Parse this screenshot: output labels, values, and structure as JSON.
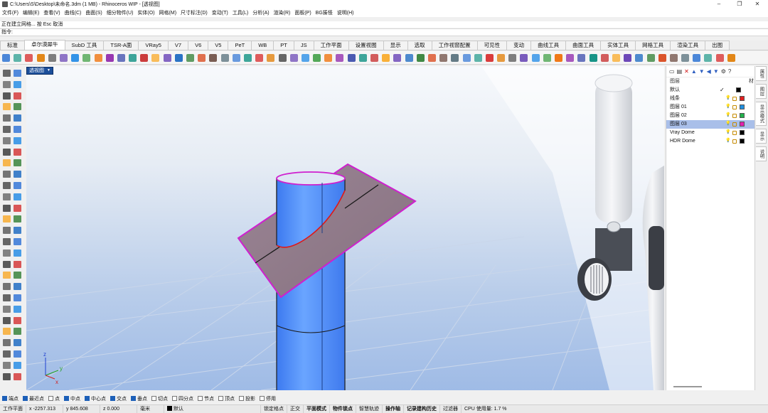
{
  "window": {
    "title": "C:\\Users\\S\\Desktop\\未命名.3dm (1 MB) - Rhinoceros WIP - [透视图]",
    "minimize": "–",
    "maximize": "❐",
    "close": "✕"
  },
  "menu": [
    "文件(F)",
    "编辑(E)",
    "查看(V)",
    "曲线(C)",
    "曲面(S)",
    "细分物件(U)",
    "实体(O)",
    "网格(M)",
    "尺寸标注(D)",
    "变动(T)",
    "工具(L)",
    "分析(A)",
    "渲染(R)",
    "面板(P)",
    "BG揍怪",
    "说明(H)"
  ],
  "command": {
    "history": "正在建立网格... 按 Esc 取消",
    "prompt": "指令:"
  },
  "tabs": [
    "标准",
    "卓尔漠犀牛",
    "SubD 工具",
    "TSR-A面",
    "VRay5",
    "V7",
    "V6",
    "V5",
    "PeT",
    "WB",
    "PT",
    "JS",
    "工作平面",
    "设置视图",
    "显示",
    "选取",
    "工作视窗配置",
    "可见性",
    "变动",
    "曲线工具",
    "曲面工具",
    "实体工具",
    "网格工具",
    "渲染工具",
    "出图"
  ],
  "active_tab": "卓尔漠犀牛",
  "viewport": {
    "label": "透视图",
    "axes": {
      "x": "x",
      "y": "y",
      "z": "z"
    }
  },
  "layers_panel": {
    "header": "图层",
    "material_col": "材",
    "layers": [
      {
        "name": "默认",
        "color": "#000000",
        "current": true,
        "selected": false
      },
      {
        "name": "线条",
        "color": "#e02020",
        "current": false,
        "selected": false
      },
      {
        "name": "图层 01",
        "color": "#1f8fe0",
        "current": false,
        "selected": false
      },
      {
        "name": "图层 02",
        "color": "#22b14c",
        "current": false,
        "selected": false
      },
      {
        "name": "图层 03",
        "color": "#e020b0",
        "current": false,
        "selected": true
      },
      {
        "name": "Vray Dome",
        "color": "#000000",
        "current": false,
        "selected": false
      },
      {
        "name": "HDR Dome",
        "color": "#000000",
        "current": false,
        "selected": false
      }
    ]
  },
  "side_tabs": [
    "属性",
    "图层",
    "显示模式",
    "显示",
    "说明"
  ],
  "osnap": [
    {
      "label": "端点",
      "on": true
    },
    {
      "label": "最近点",
      "on": true
    },
    {
      "label": "点",
      "on": false
    },
    {
      "label": "中点",
      "on": true
    },
    {
      "label": "中心点",
      "on": true
    },
    {
      "label": "交点",
      "on": true
    },
    {
      "label": "垂点",
      "on": true
    },
    {
      "label": "切点",
      "on": false
    },
    {
      "label": "四分点",
      "on": false
    },
    {
      "label": "节点",
      "on": false
    },
    {
      "label": "顶点",
      "on": false
    },
    {
      "label": "投影",
      "on": false
    },
    {
      "label": "停用",
      "on": false
    }
  ],
  "status": {
    "cplane": "工作平面",
    "x": "x -2257.313",
    "y": "y 845.608",
    "z": "z 0.000",
    "units": "毫米",
    "layer": "默认",
    "toggles": [
      "锁定格点",
      "正交",
      "平面模式",
      "物件锁点",
      "智慧轨迹",
      "操作轴",
      "记录建构历史",
      "过滤器"
    ],
    "cpu": "CPU 使用量: 1.7 %"
  }
}
